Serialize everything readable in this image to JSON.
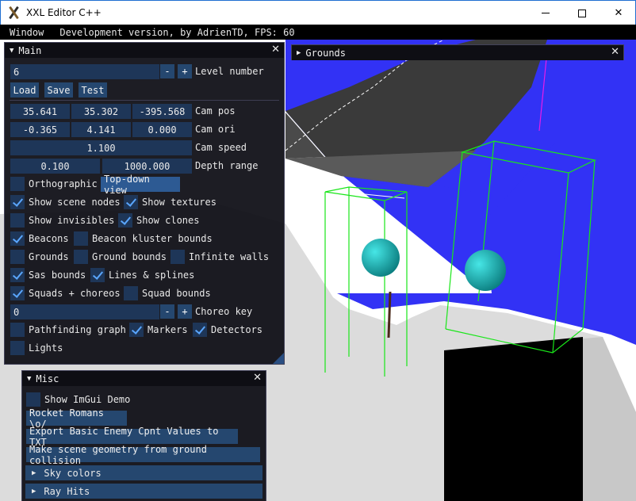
{
  "window": {
    "title": "XXL Editor C++",
    "minimize_label": "—",
    "maximize_label": "☐",
    "close_label": "✕"
  },
  "menubar": {
    "menu": "Window",
    "status": "Development version, by AdrienTD, FPS: 60"
  },
  "main_panel": {
    "title": "Main",
    "level_number_value": "6",
    "minus": "-",
    "plus": "+",
    "level_number_label": "Level number",
    "load": "Load",
    "save": "Save",
    "test": "Test",
    "cam_pos": [
      "35.641",
      "35.302",
      "-395.568"
    ],
    "cam_pos_label": "Cam pos",
    "cam_ori": [
      "-0.365",
      "4.141",
      "0.000"
    ],
    "cam_ori_label": "Cam ori",
    "cam_speed": "1.100",
    "cam_speed_label": "Cam speed",
    "depth_range": [
      "0.100",
      "1000.000"
    ],
    "depth_range_label": "Depth range",
    "orthographic": "Orthographic",
    "top_down_view": "Top-down view",
    "show_scene_nodes": "Show scene nodes",
    "show_textures": "Show textures",
    "show_invisibles": "Show invisibles",
    "show_clones": "Show clones",
    "beacons": "Beacons",
    "beacon_kluster_bounds": "Beacon kluster bounds",
    "grounds": "Grounds",
    "ground_bounds": "Ground bounds",
    "infinite_walls": "Infinite walls",
    "sas_bounds": "Sas bounds",
    "lines_splines": "Lines & splines",
    "squads_choreos": "Squads + choreos",
    "squad_bounds": "Squad bounds",
    "choreo_key_value": "0",
    "choreo_key_label": "Choreo key",
    "pathfinding_graph": "Pathfinding graph",
    "markers": "Markers",
    "detectors": "Detectors",
    "lights": "Lights",
    "checks": {
      "orthographic": false,
      "show_scene_nodes": true,
      "show_textures": true,
      "show_invisibles": false,
      "show_clones": true,
      "beacons": true,
      "beacon_kluster_bounds": false,
      "grounds": false,
      "ground_bounds": false,
      "infinite_walls": false,
      "sas_bounds": true,
      "lines_splines": true,
      "squads_choreos": true,
      "squad_bounds": false,
      "pathfinding_graph": false,
      "markers": true,
      "detectors": true,
      "lights": false
    }
  },
  "grounds_panel": {
    "title": "Grounds"
  },
  "misc_panel": {
    "title": "Misc",
    "show_imgui_demo": "Show ImGui Demo",
    "rocket_romans": "Rocket Romans \\o/",
    "export_values": "Export Basic Enemy Cpnt Values to TXT",
    "make_geometry": "Make scene geometry from ground collision",
    "sky_colors": "Sky colors",
    "ray_hits": "Ray Hits"
  },
  "colors": {
    "imgui_title_active": "#1e3a63",
    "imgui_frame": "#1e3658",
    "imgui_button": "#25476f",
    "checkmark": "#5aa6ff",
    "scene_blue": "#3232f5",
    "bounds_green": "#19e619",
    "sphere_cyan": "#1ab8b8"
  }
}
